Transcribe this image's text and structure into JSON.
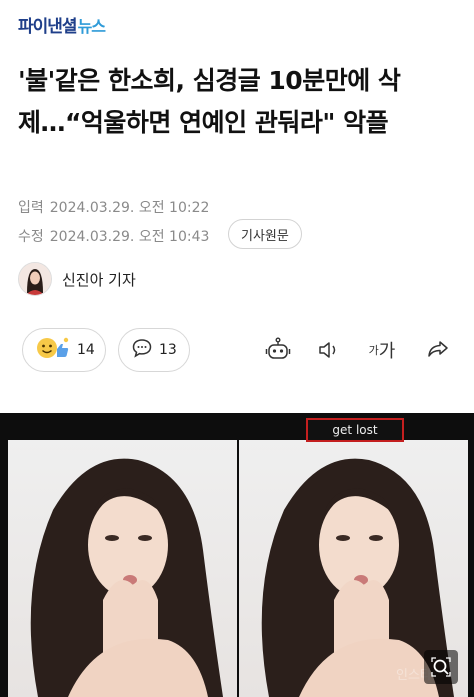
{
  "header": {
    "logo_main": "파이낸셜",
    "logo_sub": "뉴스"
  },
  "article": {
    "title": "'불'같은 한소희, 심경글 10분만에 삭제…“억울하면 연예인 관둬라\" 악플",
    "input_label": "입력",
    "input_date": "2024.03.29. 오전 10:22",
    "edit_label": "수정",
    "edit_date": "2024.03.29. 오전 10:43",
    "original_button": "기사원문",
    "reporter": "신진아 기자"
  },
  "reactions": {
    "reaction_count": "14",
    "comment_count": "13"
  },
  "toolbar": {
    "font_small": "가",
    "font_large": "가"
  },
  "photo": {
    "overlay_text": "get lost",
    "watermark": "인스타"
  },
  "icons": {
    "reaction": "emoji-reaction-icon",
    "comment": "comment-icon",
    "bot": "ai-summary-bot-icon",
    "speaker": "speaker-icon",
    "share": "share-icon",
    "zoom": "zoom-icon"
  },
  "colors": {
    "logo_main": "#1f3f8a",
    "logo_sub": "#2f9bd8",
    "overlay_border": "#c41f1f"
  }
}
